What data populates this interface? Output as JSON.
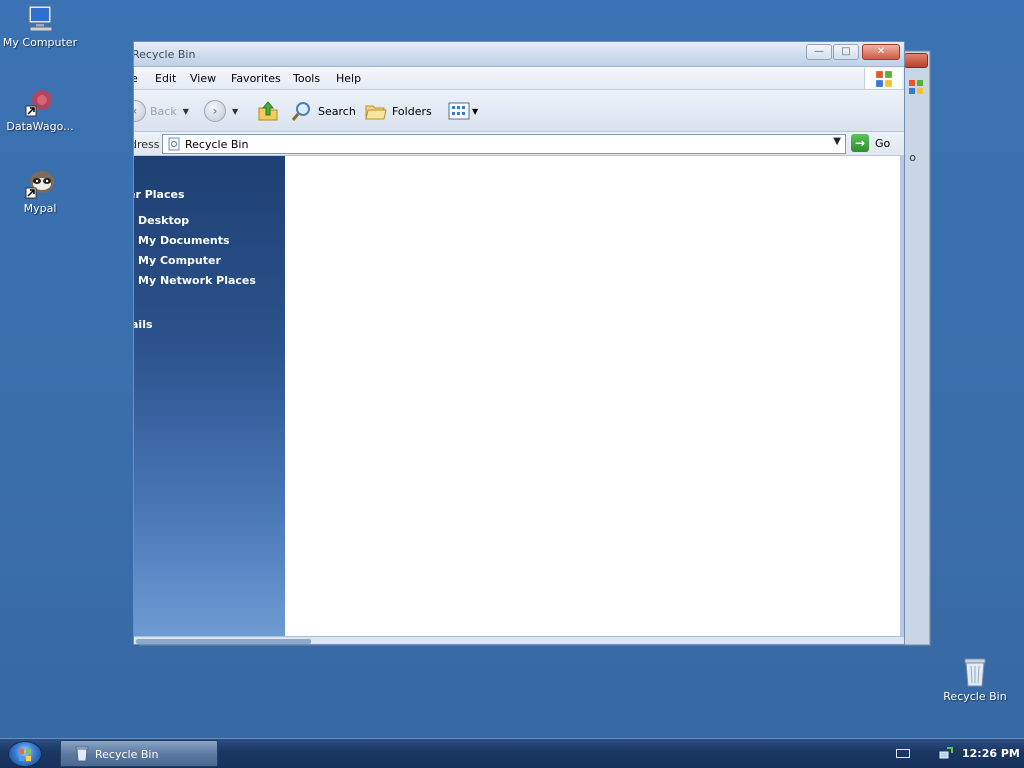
{
  "desktop": {
    "icons": [
      {
        "label": "My Computer",
        "icon": "computer-icon"
      },
      {
        "label": "DataWago...",
        "icon": "app-shortcut-icon"
      },
      {
        "label": "Mypal",
        "icon": "raccoon-shortcut-icon"
      },
      {
        "label": "Recycle Bin",
        "icon": "recycle-bin-icon"
      }
    ]
  },
  "back_window": {
    "go_label": "o"
  },
  "window": {
    "title": "Recycle Bin",
    "controls": {
      "minimize": "—",
      "maximize": "□",
      "close": "✕"
    },
    "menu": [
      "e",
      "Edit",
      "View",
      "Favorites",
      "Tools",
      "Help"
    ],
    "toolbar": {
      "back_label": "Back",
      "forward_icon": "forward-arrow-icon",
      "up_icon": "up-folder-icon",
      "search_label": "Search",
      "folders_label": "Folders",
      "views_icon": "views-icon"
    },
    "address": {
      "label": "dress",
      "value": "Recycle Bin",
      "go_label": "Go"
    },
    "sidepane": {
      "other_places_title": "er Places",
      "links": [
        "Desktop",
        "My Documents",
        "My Computer",
        "My Network Places"
      ],
      "details_title": "ails"
    }
  },
  "taskbar": {
    "start_icon": "windows-orb-icon",
    "task_label": "Recycle Bin",
    "clock": "12:26 PM"
  },
  "colors": {
    "desktop": "#3a6ea5",
    "sidepane_top": "#1e3f73",
    "sidepane_bottom": "#6e9bd2",
    "taskbar": "#1a3663"
  }
}
